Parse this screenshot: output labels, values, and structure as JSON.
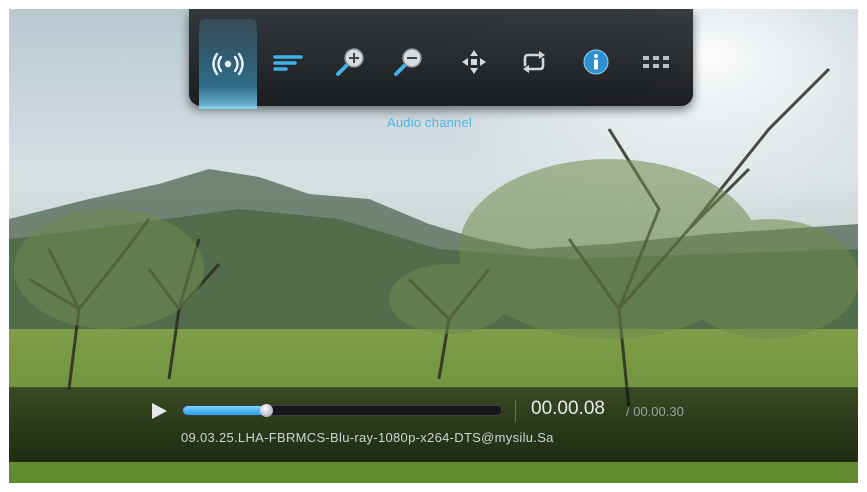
{
  "toolbar": {
    "items": [
      {
        "name": "audio-channel-icon",
        "active": true
      },
      {
        "name": "subtitle-icon",
        "active": false
      },
      {
        "name": "zoom-in-icon",
        "active": false
      },
      {
        "name": "zoom-out-icon",
        "active": false
      },
      {
        "name": "pan-icon",
        "active": false
      },
      {
        "name": "repeat-icon",
        "active": false
      },
      {
        "name": "info-icon",
        "active": false
      },
      {
        "name": "more-icon",
        "active": false
      }
    ],
    "tooltip": "Audio channel",
    "accent": "#4fb6e6"
  },
  "playback": {
    "state_icon": "play-icon",
    "progress_fraction": 0.26,
    "current_time": "00.00.08",
    "total_time": "/ 00.00.30",
    "file_name": "09.03.25.LHA-FBRMCS-Blu-ray-1080p-x264-DTS@mysilu.Sa"
  }
}
